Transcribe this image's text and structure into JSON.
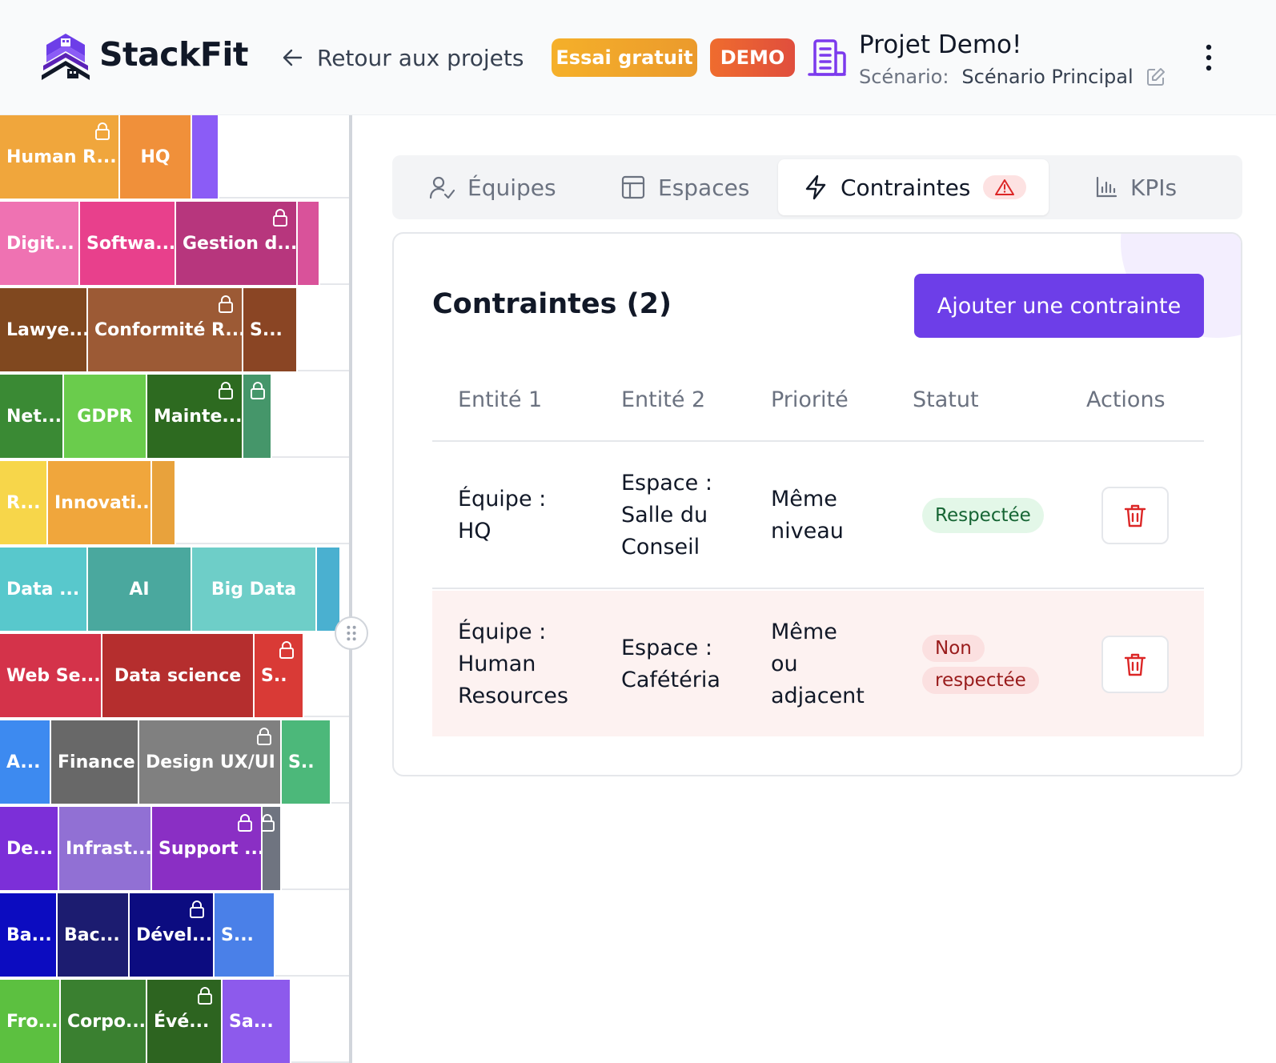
{
  "header": {
    "brand": "StackFit",
    "back_label": "Retour aux projets",
    "badge_trial": "Essai gratuit",
    "badge_demo": "DEMO",
    "project_name": "Projet Demo!",
    "scenario_label": "Scénario:",
    "scenario_value": "Scénario Principal"
  },
  "treemap": {
    "rows": [
      [
        {
          "label": "Human R...",
          "color": "#f0a63c",
          "lock": true
        },
        {
          "label": "HQ",
          "color": "#f0903a",
          "center": true
        },
        {
          "label": "",
          "color": "#8b5cf6"
        }
      ],
      [
        {
          "label": "Digit...",
          "color": "#ef72b2"
        },
        {
          "label": "Softwa...",
          "color": "#e8408c"
        },
        {
          "label": "Gestion d...",
          "color": "#b7367d",
          "lock": true
        },
        {
          "label": "",
          "color": "#d9529a"
        }
      ],
      [
        {
          "label": "Lawye...",
          "color": "#80481f"
        },
        {
          "label": "Conformité R...",
          "color": "#9c5a35",
          "lock": true
        },
        {
          "label": "S...",
          "color": "#8a4524"
        }
      ],
      [
        {
          "label": "Net...",
          "color": "#3a8a34"
        },
        {
          "label": "GDPR",
          "color": "#6acc4c",
          "center": true
        },
        {
          "label": "Mainte...",
          "color": "#2d6a20",
          "lock": true
        },
        {
          "label": "",
          "color": "#45966a",
          "lock": true
        }
      ],
      [
        {
          "label": "R...",
          "color": "#f7d64a"
        },
        {
          "label": "Innovati...",
          "color": "#f0a63c"
        },
        {
          "label": "",
          "color": "#e8a23c"
        }
      ],
      [
        {
          "label": "Data ...",
          "color": "#58c8cc"
        },
        {
          "label": "AI",
          "color": "#4aa89e",
          "center": true
        },
        {
          "label": "Big Data",
          "color": "#6ecec8",
          "center": true
        },
        {
          "label": "",
          "color": "#4ab0d0"
        }
      ],
      [
        {
          "label": "Web Se...",
          "color": "#d4334a"
        },
        {
          "label": "Data science",
          "color": "#b52e2e",
          "center": true
        },
        {
          "label": "S..",
          "color": "#d93a36",
          "lock": true
        }
      ],
      [
        {
          "label": "A...",
          "color": "#3d8af0"
        },
        {
          "label": "Finance",
          "color": "#686868"
        },
        {
          "label": "Design UX/UI",
          "color": "#808080",
          "lock": true
        },
        {
          "label": "S..",
          "color": "#4cb87a"
        }
      ],
      [
        {
          "label": "De...",
          "color": "#7c2fd8"
        },
        {
          "label": "Infrast...",
          "color": "#9170d4"
        },
        {
          "label": "Support ...",
          "color": "#8a2fc4",
          "lock": true
        },
        {
          "label": "",
          "color": "#6f7480",
          "lock": true
        }
      ],
      [
        {
          "label": "Ba...",
          "color": "#0c0cc0"
        },
        {
          "label": "Bac...",
          "color": "#1c1c70"
        },
        {
          "label": "Dével...",
          "color": "#0c0c80",
          "lock": true
        },
        {
          "label": "S...",
          "color": "#4a80e8"
        }
      ],
      [
        {
          "label": "Fro...",
          "color": "#5cc040"
        },
        {
          "label": "Corpo...",
          "color": "#3a8030"
        },
        {
          "label": "Évé...",
          "color": "#2d6420",
          "lock": true
        },
        {
          "label": "Sa...",
          "color": "#8d5aec"
        }
      ]
    ]
  },
  "tabs": [
    {
      "label": "Équipes",
      "icon": "user-icon"
    },
    {
      "label": "Espaces",
      "icon": "layout-icon"
    },
    {
      "label": "Contraintes",
      "icon": "lightning-icon",
      "active": true
    },
    {
      "label": "KPIs",
      "icon": "chart-icon"
    }
  ],
  "card": {
    "title": "Contraintes (2)",
    "add_button": "Ajouter une contrainte",
    "columns": [
      "Entité 1",
      "Entité 2",
      "Priorité",
      "Statut",
      "Actions"
    ],
    "rows": [
      {
        "entity1": "Équipe :\nHQ",
        "entity2": "Espace :\nSalle du\nConseil",
        "priority": "Même\nniveau",
        "status": "Respectée",
        "ok": true
      },
      {
        "entity1": "Équipe :\nHuman\nResources",
        "entity2": "Espace :\nCafétéria",
        "priority": "Même\nou\nadjacent",
        "status": "Non respectée",
        "ok": false
      }
    ]
  },
  "colors": {
    "accent": "#6d3ee8",
    "ok": "#166534",
    "bad": "#991b1b"
  }
}
